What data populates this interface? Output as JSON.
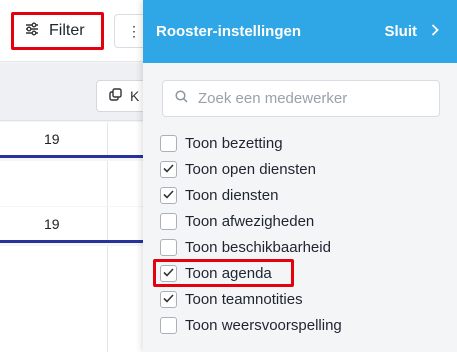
{
  "toolbar": {
    "filter_label": "Filter",
    "more_label": "⋮",
    "copy_label": "K"
  },
  "schedule": {
    "day_numbers": [
      "19",
      "19"
    ]
  },
  "panel": {
    "title": "Rooster-instellingen",
    "close_label": "Sluit",
    "search_placeholder": "Zoek een medewerker",
    "options": [
      {
        "label": "Toon bezetting",
        "checked": false
      },
      {
        "label": "Toon open diensten",
        "checked": true
      },
      {
        "label": "Toon diensten",
        "checked": true
      },
      {
        "label": "Toon afwezigheden",
        "checked": false
      },
      {
        "label": "Toon beschikbaarheid",
        "checked": false
      },
      {
        "label": "Toon agenda",
        "checked": true
      },
      {
        "label": "Toon teamnotities",
        "checked": true
      },
      {
        "label": "Toon weersvoorspelling",
        "checked": false
      }
    ]
  },
  "colors": {
    "header": "#2fa6e6",
    "highlight": "#e3000f",
    "day_underline": "#28329b"
  }
}
